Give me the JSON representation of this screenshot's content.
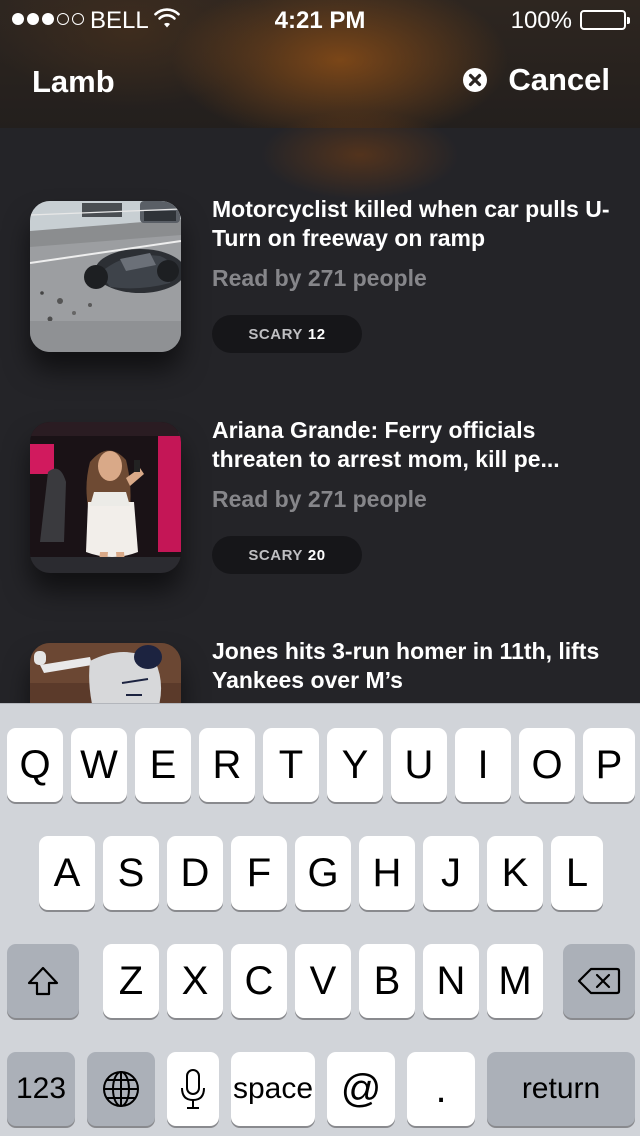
{
  "status_bar": {
    "carrier": "BELL",
    "time": "4:21 PM",
    "battery": "100%"
  },
  "nav": {
    "title": "Lamb",
    "cancel_label": "Cancel",
    "cancel_icon": "close-circle-icon"
  },
  "feed": {
    "items": [
      {
        "title": "Motorcyclist killed when car pulls U-Turn on freeway on ramp",
        "readers": "Read by 271 people",
        "badge_label": "SCARY",
        "badge_count": "12"
      },
      {
        "title": "Ariana Grande: Ferry officials threaten to arrest mom, kill pe...",
        "readers": "Read by 271 people",
        "badge_label": "SCARY",
        "badge_count": "20"
      },
      {
        "title": "Jones hits 3-run homer in 11th, lifts Yankees over M’s"
      }
    ]
  },
  "keyboard": {
    "row1": [
      "Q",
      "W",
      "E",
      "R",
      "T",
      "Y",
      "U",
      "I",
      "O",
      "P"
    ],
    "row2": [
      "A",
      "S",
      "D",
      "F",
      "G",
      "H",
      "J",
      "K",
      "L"
    ],
    "row3": [
      "Z",
      "X",
      "C",
      "V",
      "B",
      "N",
      "M"
    ],
    "numbers": "123",
    "space": "space",
    "at": "@",
    "period": ".",
    "return": "return",
    "icons": {
      "shift": "shift-arrow-icon",
      "delete": "backspace-icon",
      "globe": "globe-icon",
      "mic": "microphone-icon"
    }
  },
  "colors": {
    "background": "#242428",
    "secondary_text": "#86868a",
    "badge_bg": "#161619",
    "keyboard_bg": "#d1d4d9"
  }
}
